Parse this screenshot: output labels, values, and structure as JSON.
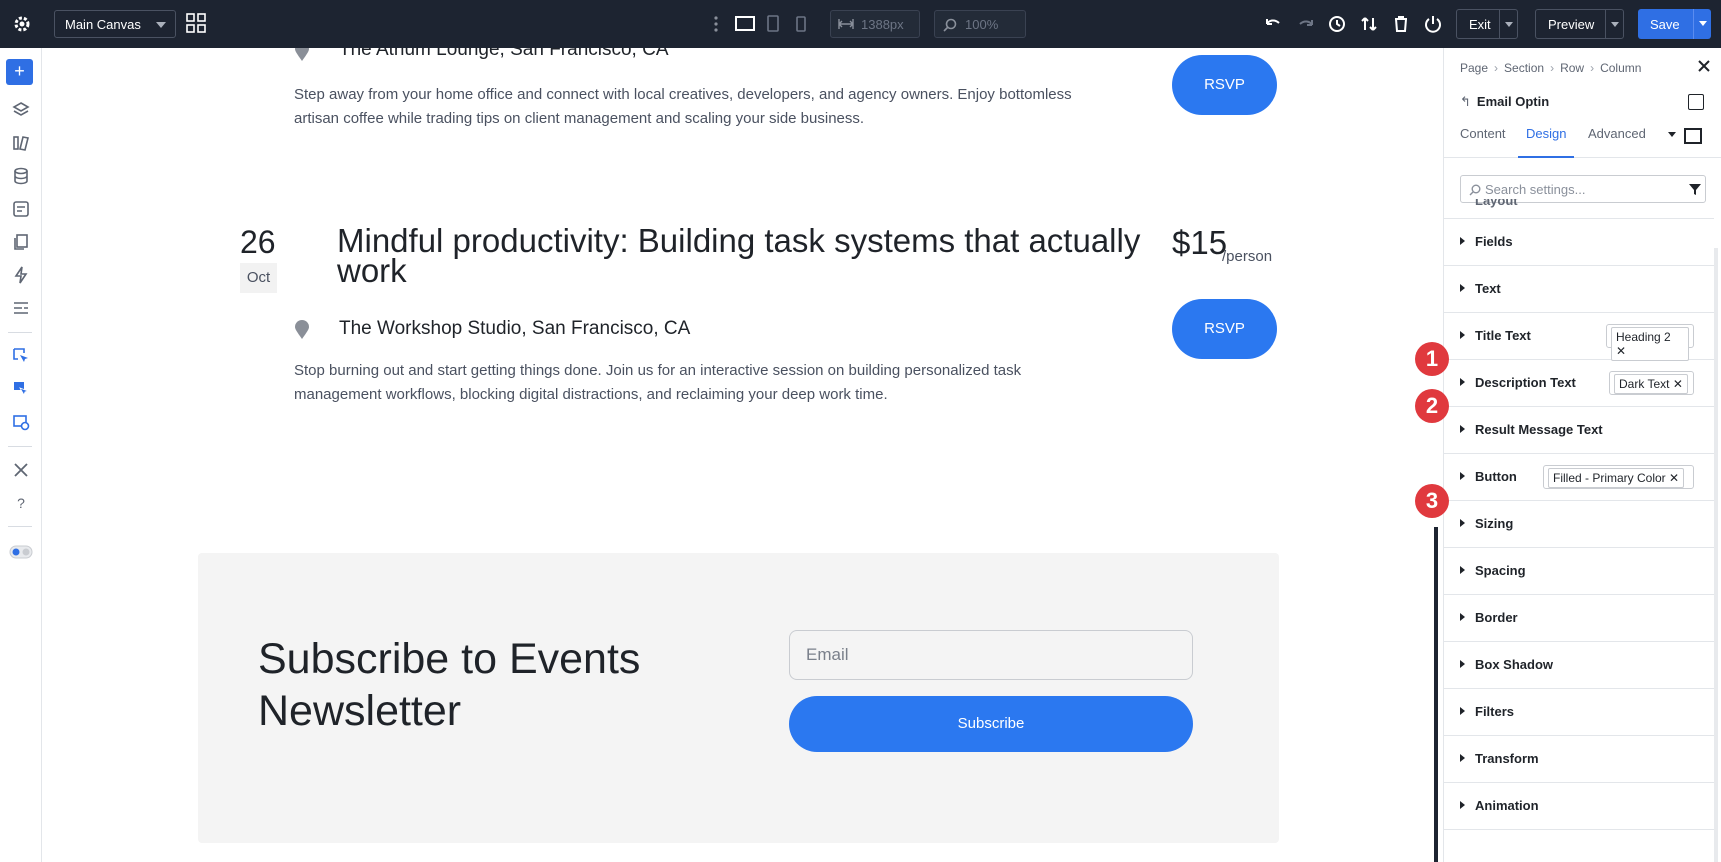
{
  "topbar": {
    "canvas_select": "Main Canvas",
    "width_value": "1388px",
    "zoom_value": "100%",
    "exit_label": "Exit",
    "preview_label": "Preview",
    "save_label": "Save"
  },
  "canvas": {
    "event1": {
      "location": "The Atrium Lounge, San Francisco, CA",
      "description": "Step away from your home office and connect with local creatives, developers, and agency owners. Enjoy bottomless artisan coffee while trading tips on client management and scaling your side business.",
      "rsvp_label": "RSVP"
    },
    "event2": {
      "day": "26",
      "month": "Oct",
      "title": "Mindful productivity: Building task systems that actually work",
      "price": "$15",
      "price_unit": "/person",
      "location": "The Workshop Studio, San Francisco, CA",
      "description": "Stop burning out and start getting things done. Join us for an interactive session on building personalized task management workflows, blocking digital distractions, and reclaiming your deep work time.",
      "rsvp_label": "RSVP"
    },
    "newsletter": {
      "title": "Subscribe to Events Newsletter",
      "email_placeholder": "Email",
      "button_label": "Subscribe"
    }
  },
  "panel": {
    "breadcrumb": [
      "Page",
      "Section",
      "Row",
      "Column"
    ],
    "module_title": "Email Optin",
    "tabs": [
      "Content",
      "Design",
      "Advanced"
    ],
    "active_tab": "Design",
    "search_placeholder": "Search settings...",
    "sections": [
      {
        "label": "Layout"
      },
      {
        "label": "Fields"
      },
      {
        "label": "Text"
      },
      {
        "label": "Title Text",
        "preset": "Heading 2",
        "badge": "1"
      },
      {
        "label": "Description Text",
        "preset": "Dark Text",
        "badge": "2"
      },
      {
        "label": "Result Message Text"
      },
      {
        "label": "Button",
        "preset": "Filled - Primary Color",
        "badge": "3"
      },
      {
        "label": "Sizing"
      },
      {
        "label": "Spacing"
      },
      {
        "label": "Border"
      },
      {
        "label": "Box Shadow"
      },
      {
        "label": "Filters"
      },
      {
        "label": "Transform"
      },
      {
        "label": "Animation"
      }
    ]
  },
  "colors": {
    "topbar_bg": "#1d2431",
    "accent": "#2f6fe4",
    "button_blue": "#2b78f0",
    "badge_red": "#e0393e"
  },
  "icons": [
    "gear-icon",
    "grid-icon",
    "desktop-icon",
    "tablet-icon",
    "phone-icon",
    "undo-icon",
    "redo-icon",
    "history-icon",
    "sort-icon",
    "trash-icon",
    "power-icon",
    "plus-icon",
    "layers-icon",
    "location-pin-icon",
    "close-icon",
    "filter-icon",
    "search-icon"
  ]
}
